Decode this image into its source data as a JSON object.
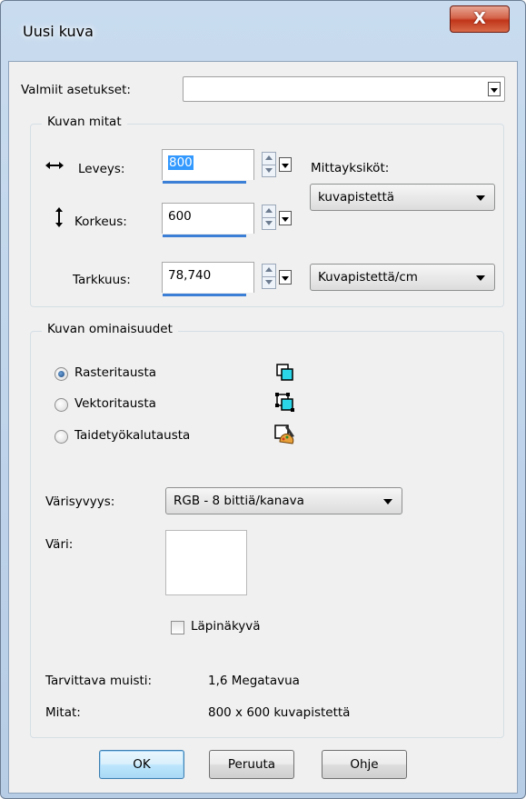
{
  "window": {
    "title": "Uusi kuva",
    "close_glyph": "X"
  },
  "presets": {
    "label": "Valmiit asetukset:",
    "value": ""
  },
  "dimensions": {
    "group_title": "Kuvan mitat",
    "width": {
      "label": "Leveys:",
      "value": "800",
      "icon": "horizontal-arrows-icon"
    },
    "height": {
      "label": "Korkeus:",
      "value": "600",
      "icon": "vertical-arrows-icon"
    },
    "resolution": {
      "label": "Tarkkuus:",
      "value": "78,740"
    },
    "units_label": "Mittayksiköt:",
    "units_value": "kuvapistettä",
    "resolution_units_value": "Kuvapistettä/cm"
  },
  "properties": {
    "group_title": "Kuvan ominaisuudet",
    "background_options": [
      {
        "label": "Rasteritausta",
        "checked": true,
        "icon": "raster-layer-icon"
      },
      {
        "label": "Vektoritausta",
        "checked": false,
        "icon": "vector-layer-icon"
      },
      {
        "label": "Taidetyökalutausta",
        "checked": false,
        "icon": "art-media-layer-icon"
      }
    ],
    "color_depth_label": "Värisyvyys:",
    "color_depth_value": "RGB - 8 bittiä/kanava",
    "color_label": "Väri:",
    "color_value": "#ffffff",
    "transparent_label": "Läpinäkyvä",
    "transparent_checked": false
  },
  "info": {
    "memory_label": "Tarvittava muisti:",
    "memory_value": "1,6 Megatavua",
    "dimensions_label": "Mitat:",
    "dimensions_value": "800 x 600 kuvapistettä"
  },
  "buttons": {
    "ok": "OK",
    "cancel": "Peruuta",
    "help": "Ohje"
  },
  "colors": {
    "accent": "#3399ff",
    "field_underline": "#3c7fd6"
  }
}
